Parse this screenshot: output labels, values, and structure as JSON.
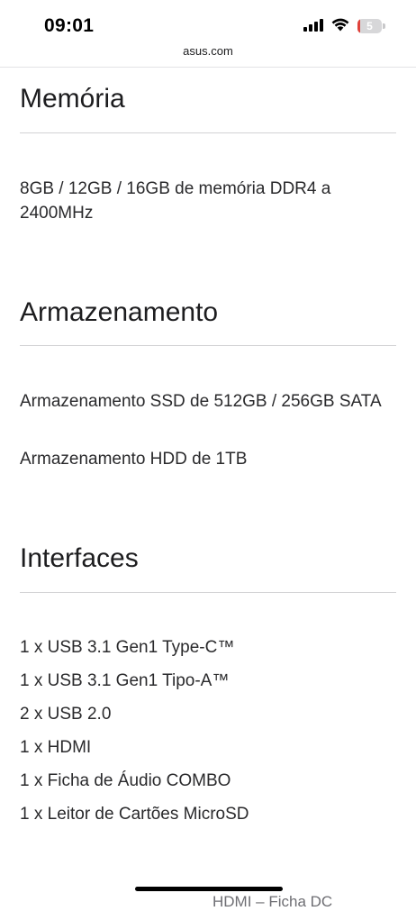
{
  "status_bar": {
    "time": "09:01",
    "battery_level": "5",
    "battery_color": "#e0413a",
    "icons": [
      "signal-bars-icon",
      "wifi-icon",
      "battery-icon"
    ]
  },
  "browser": {
    "url": "asus.com"
  },
  "sections": {
    "memoria": {
      "title": "Memória",
      "lines": [
        "8GB / 12GB / 16GB de memória DDR4 a 2400MHz"
      ]
    },
    "armazenamento": {
      "title": "Armazenamento",
      "lines": [
        "Armazenamento SSD de 512GB / 256GB SATA",
        "Armazenamento HDD de 1TB"
      ]
    },
    "interfaces": {
      "title": "Interfaces",
      "lines": [
        "1 x USB 3.1 Gen1 Type-C™",
        "1 x USB 3.1 Gen1 Tipo-A™",
        "2 x USB 2.0",
        "1 x HDMI",
        "1 x Ficha de Áudio COMBO",
        "1 x Leitor de Cartões MicroSD"
      ]
    }
  },
  "partially_visible_text": "HDMI – Ficha DC"
}
